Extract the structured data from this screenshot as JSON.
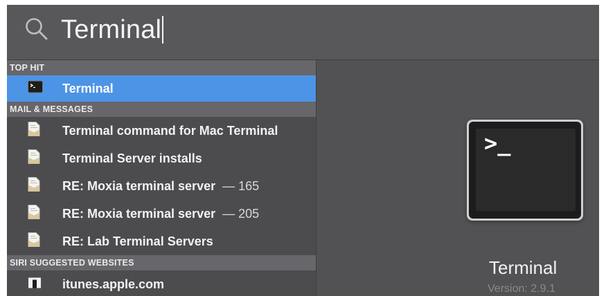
{
  "search": {
    "query": "Terminal"
  },
  "results": {
    "sections": [
      {
        "header": "TOP HIT",
        "items": [
          {
            "label": "Terminal",
            "icon": "terminal-app-icon",
            "selected": true
          }
        ]
      },
      {
        "header": "MAIL & MESSAGES",
        "items": [
          {
            "label": "Terminal command for Mac Terminal",
            "icon": "mail-document-icon"
          },
          {
            "label": "Terminal Server installs",
            "icon": "mail-document-icon"
          },
          {
            "label": "RE: Moxia terminal server",
            "count": "— 165",
            "icon": "mail-document-icon"
          },
          {
            "label": "RE: Moxia terminal server",
            "count": "— 205",
            "icon": "mail-document-icon"
          },
          {
            "label": "RE: Lab Terminal Servers",
            "icon": "mail-document-icon"
          }
        ]
      },
      {
        "header": "SIRI SUGGESTED WEBSITES",
        "items": [
          {
            "label": "itunes.apple.com",
            "icon": "website-icon"
          }
        ]
      }
    ]
  },
  "preview": {
    "prompt": ">_",
    "app_name": "Terminal",
    "version": "Version: 2.9.1"
  },
  "colors": {
    "selection": "#4d94e6",
    "window_background": "#525154"
  }
}
